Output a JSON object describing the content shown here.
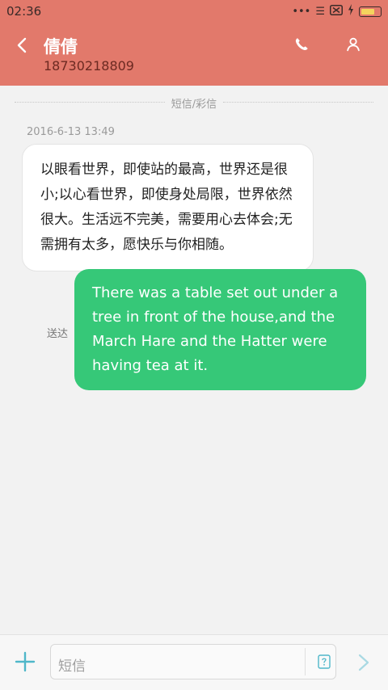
{
  "status_bar": {
    "time": "02:36",
    "icons": [
      "more-dots-icon",
      "signal-icon",
      "no-sim-icon",
      "charging-icon",
      "battery-icon"
    ]
  },
  "header": {
    "contact_name": "倩倩",
    "phone_number": "18730218809",
    "background_color": "#e2796b"
  },
  "thread": {
    "divider_label": "短信/彩信",
    "messages": [
      {
        "direction": "received",
        "timestamp": "2016-6-13 13:49",
        "text": "以眼看世界，即使站的最高，世界还是很小;以心看世界，即使身处局限，世界依然很大。生活远不完美，需要用心去体会;无需拥有太多，愿快乐与你相随。"
      },
      {
        "direction": "sent",
        "status": "送达",
        "text": "There was a table set out under a tree in front of the house,and the March Hare and the Hatter were having tea at it.",
        "bubble_color": "#36c878"
      }
    ]
  },
  "composer": {
    "placeholder": "短信",
    "icons": [
      "plus-icon",
      "sms-type-icon",
      "send-icon"
    ]
  }
}
